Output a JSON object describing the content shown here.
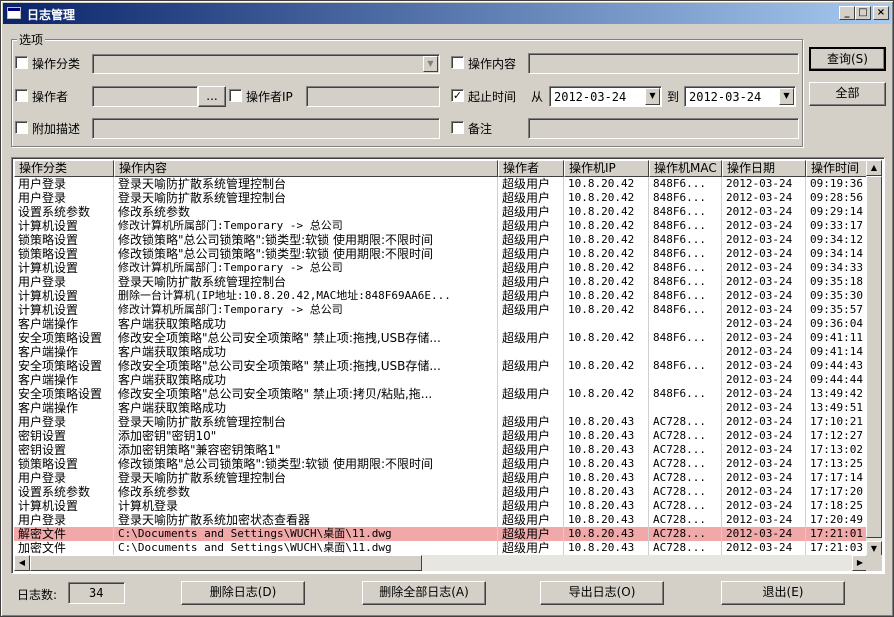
{
  "window": {
    "title": "日志管理",
    "min": "_",
    "max": "□",
    "close": "×"
  },
  "options": {
    "group_title": "选项",
    "op_category": {
      "label": "操作分类",
      "checked": false
    },
    "op_content": {
      "label": "操作内容",
      "checked": false
    },
    "operator": {
      "label": "操作者",
      "checked": false,
      "browse": "..."
    },
    "operator_ip": {
      "label": "操作者IP",
      "checked": false
    },
    "date_range": {
      "label": "起止时间",
      "checked": true,
      "check_mark": "✓",
      "from_label": "从",
      "from": "2012-03-24",
      "to_label": "到",
      "to": "2012-03-24"
    },
    "extra_desc": {
      "label": "附加描述",
      "checked": false
    },
    "remark": {
      "label": "备注",
      "checked": false
    }
  },
  "buttons": {
    "query": "查询(S)",
    "all": "全部",
    "delete": "删除日志(D)",
    "delete_all": "删除全部日志(A)",
    "export": "导出日志(O)",
    "exit": "退出(E)"
  },
  "log_count": {
    "label": "日志数:",
    "value": "34"
  },
  "table": {
    "columns": [
      "操作分类",
      "操作内容",
      "操作者",
      "操作机IP",
      "操作机MAC",
      "操作日期",
      "操作时间"
    ],
    "rows": [
      [
        "用户登录",
        "登录天喻防扩散系统管理控制台",
        "超级用户",
        "10.8.20.42",
        "848F6...",
        "2012-03-24",
        "09:19:36"
      ],
      [
        "用户登录",
        "登录天喻防扩散系统管理控制台",
        "超级用户",
        "10.8.20.42",
        "848F6...",
        "2012-03-24",
        "09:28:56"
      ],
      [
        "设置系统参数",
        "修改系统参数",
        "超级用户",
        "10.8.20.42",
        "848F6...",
        "2012-03-24",
        "09:29:14"
      ],
      [
        "计算机设置",
        "修改计算机所属部门:Temporary -> 总公司",
        "超级用户",
        "10.8.20.42",
        "848F6...",
        "2012-03-24",
        "09:33:17"
      ],
      [
        "锁策略设置",
        "修改锁策略\"总公司锁策略\":锁类型:软锁 使用期限:不限时间",
        "超级用户",
        "10.8.20.42",
        "848F6...",
        "2012-03-24",
        "09:34:12"
      ],
      [
        "锁策略设置",
        "修改锁策略\"总公司锁策略\":锁类型:软锁 使用期限:不限时间",
        "超级用户",
        "10.8.20.42",
        "848F6...",
        "2012-03-24",
        "09:34:14"
      ],
      [
        "计算机设置",
        "修改计算机所属部门:Temporary -> 总公司",
        "超级用户",
        "10.8.20.42",
        "848F6...",
        "2012-03-24",
        "09:34:33"
      ],
      [
        "用户登录",
        "登录天喻防扩散系统管理控制台",
        "超级用户",
        "10.8.20.42",
        "848F6...",
        "2012-03-24",
        "09:35:18"
      ],
      [
        "计算机设置",
        "删除一台计算机(IP地址:10.8.20.42,MAC地址:848F69AA6E...",
        "超级用户",
        "10.8.20.42",
        "848F6...",
        "2012-03-24",
        "09:35:30"
      ],
      [
        "计算机设置",
        "修改计算机所属部门:Temporary -> 总公司",
        "超级用户",
        "10.8.20.42",
        "848F6...",
        "2012-03-24",
        "09:35:57"
      ],
      [
        "客户端操作",
        "客户端获取策略成功",
        "",
        "",
        "",
        "2012-03-24",
        "09:36:04"
      ],
      [
        "安全项策略设置",
        "修改安全项策略\"总公司安全项策略\" 禁止项:拖拽,USB存储...",
        "超级用户",
        "10.8.20.42",
        "848F6...",
        "2012-03-24",
        "09:41:11"
      ],
      [
        "客户端操作",
        "客户端获取策略成功",
        "",
        "",
        "",
        "2012-03-24",
        "09:41:14"
      ],
      [
        "安全项策略设置",
        "修改安全项策略\"总公司安全项策略\" 禁止项:拖拽,USB存储...",
        "超级用户",
        "10.8.20.42",
        "848F6...",
        "2012-03-24",
        "09:44:43"
      ],
      [
        "客户端操作",
        "客户端获取策略成功",
        "",
        "",
        "",
        "2012-03-24",
        "09:44:44"
      ],
      [
        "安全项策略设置",
        "修改安全项策略\"总公司安全项策略\" 禁止项:拷贝/粘贴,拖...",
        "超级用户",
        "10.8.20.42",
        "848F6...",
        "2012-03-24",
        "13:49:42"
      ],
      [
        "客户端操作",
        "客户端获取策略成功",
        "",
        "",
        "",
        "2012-03-24",
        "13:49:51"
      ],
      [
        "用户登录",
        "登录天喻防扩散系统管理控制台",
        "超级用户",
        "10.8.20.43",
        "AC728...",
        "2012-03-24",
        "17:10:21"
      ],
      [
        "密钥设置",
        "添加密钥\"密钥10\"",
        "超级用户",
        "10.8.20.43",
        "AC728...",
        "2012-03-24",
        "17:12:27"
      ],
      [
        "密钥设置",
        "添加密钥策略\"兼容密钥策略1\"",
        "超级用户",
        "10.8.20.43",
        "AC728...",
        "2012-03-24",
        "17:13:02"
      ],
      [
        "锁策略设置",
        "修改锁策略\"总公司锁策略\":锁类型:软锁 使用期限:不限时间",
        "超级用户",
        "10.8.20.43",
        "AC728...",
        "2012-03-24",
        "17:13:25"
      ],
      [
        "用户登录",
        "登录天喻防扩散系统管理控制台",
        "超级用户",
        "10.8.20.43",
        "AC728...",
        "2012-03-24",
        "17:17:14"
      ],
      [
        "设置系统参数",
        "修改系统参数",
        "超级用户",
        "10.8.20.43",
        "AC728...",
        "2012-03-24",
        "17:17:20"
      ],
      [
        "计算机设置",
        "计算机登录",
        "超级用户",
        "10.8.20.43",
        "AC728...",
        "2012-03-24",
        "17:18:25"
      ],
      [
        "用户登录",
        "登录天喻防扩散系统加密状态查看器",
        "超级用户",
        "10.8.20.43",
        "AC728...",
        "2012-03-24",
        "17:20:49"
      ],
      [
        "解密文件",
        "C:\\Documents and Settings\\WUCH\\桌面\\11.dwg",
        "超级用户",
        "10.8.20.43",
        "AC728...",
        "2012-03-24",
        "17:21:01"
      ],
      [
        "加密文件",
        "C:\\Documents and Settings\\WUCH\\桌面\\11.dwg",
        "超级用户",
        "10.8.20.43",
        "AC728...",
        "2012-03-24",
        "17:21:03"
      ]
    ],
    "selected_row": 25
  },
  "colors": {
    "titlebar_start": "#0a246a",
    "titlebar_end": "#a6caf0",
    "selected_row": "#f0a8a8",
    "face": "#d4d0c8"
  }
}
